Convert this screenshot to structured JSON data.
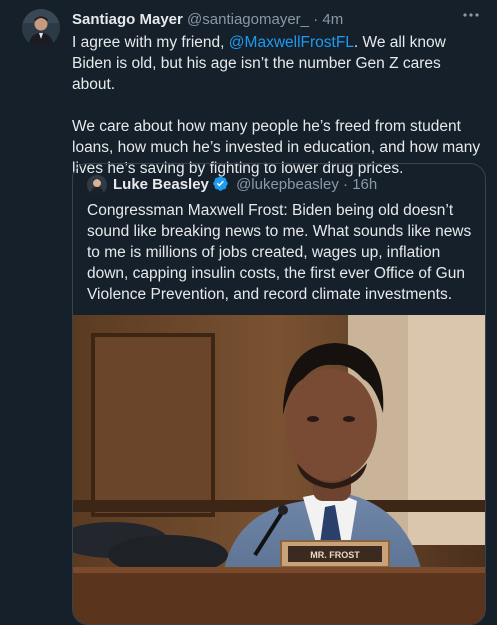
{
  "tweet": {
    "author_name": "Santiago Mayer",
    "author_handle": "@santiagomayer_",
    "separator": "·",
    "time": "4m",
    "more_icon": "more-dots-icon",
    "text_part1": "I agree with my friend, ",
    "mention": "@MaxwellFrostFL",
    "text_part2": ". We all know Biden is old, but his age isn’t the number Gen Z cares about.",
    "text_para2": "We care about how many people he’s freed from student loans, how much he’s invested in education, and how many lives he’s saving by fighting to lower drug prices."
  },
  "quote": {
    "author_name": "Luke Beasley",
    "author_handle": "@lukepbeasley",
    "separator": "·",
    "time": "16h",
    "verified_icon": "verified-badge-icon",
    "text": "Congressman Maxwell Frost: Biden being old doesn’t sound like breaking news to me. What sounds like news to me is millions of jobs created, wages up, inflation down, capping insulin costs, the first ever Office of Gun Violence Prevention, and record climate investments.",
    "photo": {
      "nameplate_text": "MR. FROST"
    }
  },
  "colors": {
    "background": "#15202b",
    "text": "#e7e9ea",
    "muted": "#8b98a5",
    "link": "#1d9bf0",
    "border": "#38444d"
  }
}
